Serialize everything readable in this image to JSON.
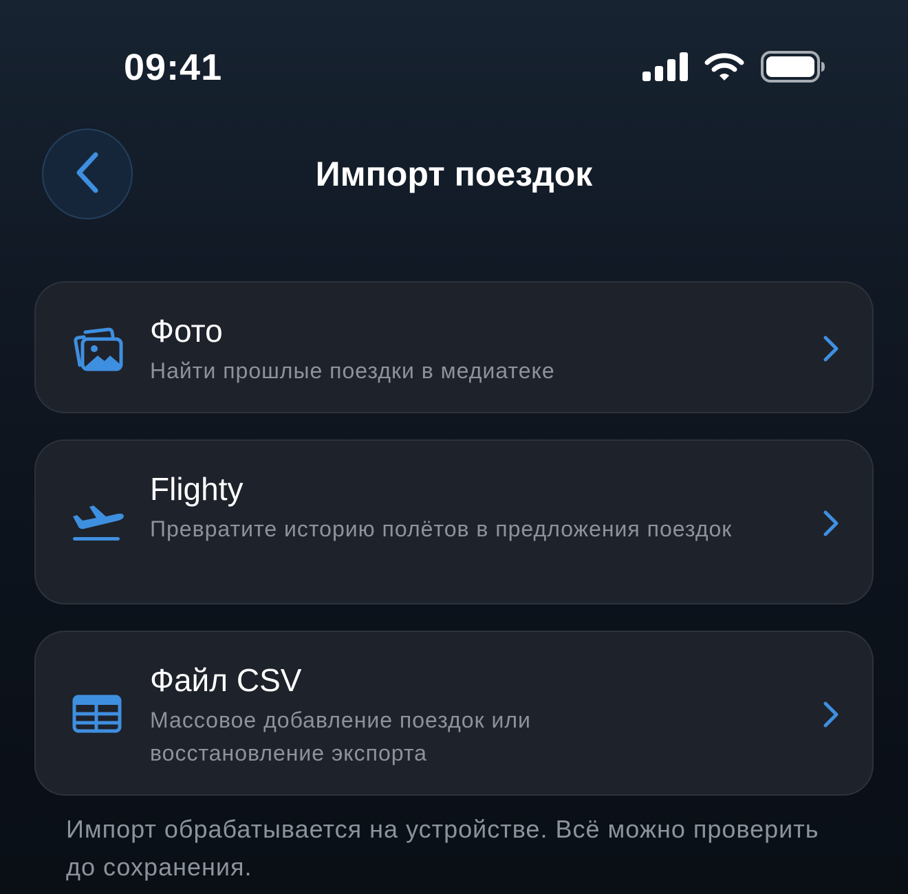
{
  "status_bar": {
    "time": "09:41",
    "icons": [
      "cellular-signal-icon",
      "wifi-icon",
      "battery-icon"
    ]
  },
  "header": {
    "title": "Импорт поездок",
    "back_icon": "chevron-left-icon"
  },
  "sources": [
    {
      "title": "Фото",
      "subtitle": "Найти прошлые поездки в медиатеке",
      "icon": "photos-icon"
    },
    {
      "title": "Flighty",
      "subtitle": "Превратите историю полётов в предложения поездок",
      "icon": "airplane-departure-icon"
    },
    {
      "title": "Файл CSV",
      "subtitle": "Массовое добавление поездок или восстановление экспорта",
      "icon": "table-icon"
    }
  ],
  "footer": {
    "note": "Импорт обрабатывается на устройстве. Всё можно проверить до сохранения."
  },
  "colors": {
    "accent": "#3f8fe0",
    "card_background": "#1e222a",
    "card_border": "#2d323b",
    "secondary_text": "#8d939c",
    "back_button_background": "#16263a"
  }
}
